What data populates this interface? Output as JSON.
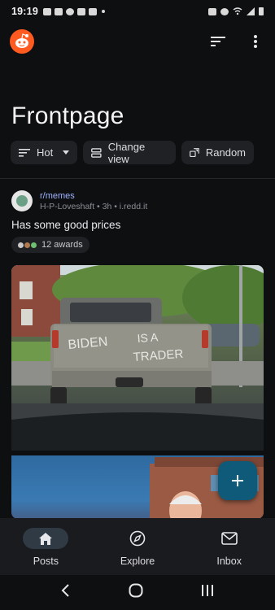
{
  "status_bar": {
    "time": "19:19"
  },
  "header": {
    "logo": "reddit-snoo-logo",
    "sort_icon": "sort-icon",
    "more_icon": "more-vertical-icon"
  },
  "page": {
    "title": "Frontpage"
  },
  "toolbar": {
    "sort_label": "Hot",
    "view_label": "Change view",
    "random_label": "Random"
  },
  "post": {
    "subreddit_prefix": "r/",
    "subreddit": "memes",
    "byline": "H-P-Loveshaft • 3h • i.redd.it",
    "title": "Has some good prices",
    "awards_label": "12 awards",
    "image_text": "BIDEN IS A TRADER"
  },
  "fab": {
    "icon": "plus-icon"
  },
  "bottom_nav": {
    "items": [
      {
        "label": "Posts",
        "icon": "home-icon",
        "active": true
      },
      {
        "label": "Explore",
        "icon": "compass-icon",
        "active": false
      },
      {
        "label": "Inbox",
        "icon": "mail-icon",
        "active": false
      }
    ]
  },
  "system_nav": {
    "back_icon": "back-icon",
    "home_icon": "home-circle-icon",
    "recents_icon": "recents-icon"
  },
  "colors": {
    "background": "#0e0f11",
    "chip": "#1f2124",
    "accent_link": "#9fb4ff",
    "fab": "#0f5a78",
    "nav_active": "#2f3a45"
  }
}
